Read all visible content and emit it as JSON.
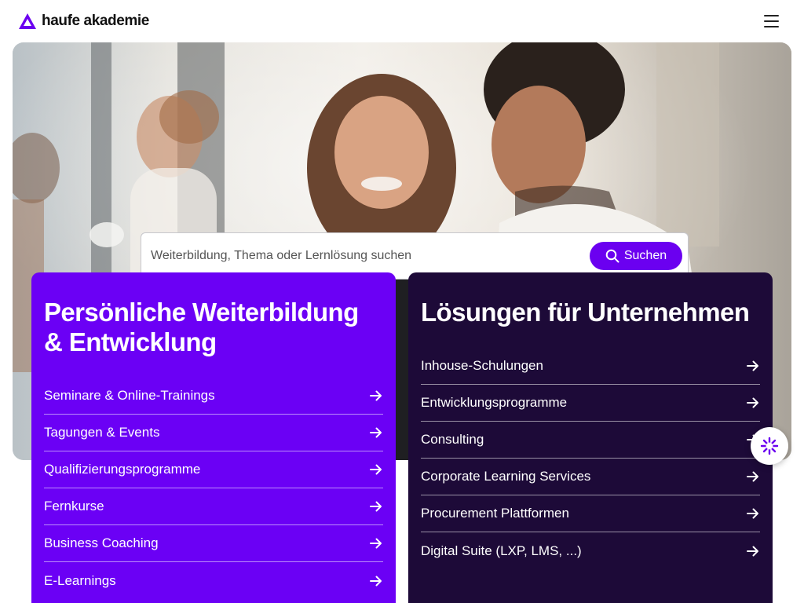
{
  "brand": {
    "name": "haufe akademie",
    "accent_color": "#6b00f0",
    "dark_color": "#1d0a38"
  },
  "header": {
    "menu_icon": "hamburger-menu-icon"
  },
  "search": {
    "placeholder": "Weiterbildung, Thema oder Lernlösung suchen",
    "button_label": "Suchen",
    "icon": "search-icon"
  },
  "personal": {
    "title": "Persönliche Weiterbildung & Entwicklung",
    "items": [
      {
        "label": "Seminare & Online-Trainings"
      },
      {
        "label": "Tagungen & Events"
      },
      {
        "label": "Qualifizierungsprogramme"
      },
      {
        "label": "Fernkurse"
      },
      {
        "label": "Business Coaching"
      },
      {
        "label": "E-Learnings"
      }
    ]
  },
  "business": {
    "title": "Lösungen für Unternehmen",
    "items": [
      {
        "label": "Inhouse-Schulungen"
      },
      {
        "label": "Entwicklungsprogramme"
      },
      {
        "label": "Consulting"
      },
      {
        "label": "Corporate Learning Services"
      },
      {
        "label": "Procurement Plattformen"
      },
      {
        "label": "Digital Suite (LXP, LMS, ...)"
      }
    ]
  },
  "chat": {
    "icon": "chat-assistant-icon"
  }
}
